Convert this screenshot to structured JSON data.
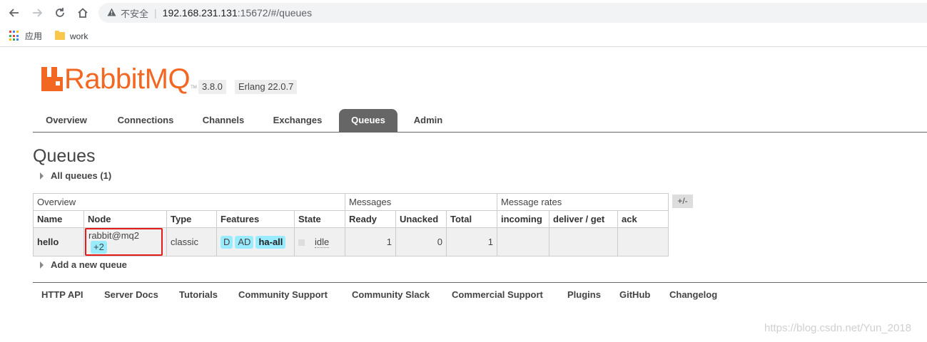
{
  "browser": {
    "insecure_label": "不安全",
    "url_host": "192.168.231.131",
    "url_path": ":15672/#/queues",
    "bookmarks": [
      {
        "label": "应用",
        "icon": "apps-grid-icon"
      },
      {
        "label": "work",
        "icon": "folder-icon"
      }
    ]
  },
  "app": {
    "logo_text": "RabbitMQ",
    "logo_tm": "TM",
    "version": "3.8.0",
    "erlang": "Erlang 22.0.7"
  },
  "tabs": [
    "Overview",
    "Connections",
    "Channels",
    "Exchanges",
    "Queues",
    "Admin"
  ],
  "active_tab": "Queues",
  "page": {
    "title": "Queues",
    "all_queues": "All queues (1)",
    "add_queue": "Add a new queue"
  },
  "table": {
    "groups": [
      "Overview",
      "Messages",
      "Message rates"
    ],
    "columns": [
      "Name",
      "Node",
      "Type",
      "Features",
      "State",
      "Ready",
      "Unacked",
      "Total",
      "incoming",
      "deliver / get",
      "ack"
    ],
    "toggle": "+/-",
    "rows": [
      {
        "name": "hello",
        "node": "rabbit@mq2",
        "node_extra": "+2",
        "type": "classic",
        "features": [
          "D",
          "AD",
          "ha-all"
        ],
        "state": "idle",
        "ready": "1",
        "unacked": "0",
        "total": "1",
        "incoming": "",
        "deliver_get": "",
        "ack": ""
      }
    ]
  },
  "footer": [
    "HTTP API",
    "Server Docs",
    "Tutorials",
    "Community Support",
    "Community Slack",
    "Commercial Support",
    "Plugins",
    "GitHub",
    "Changelog"
  ],
  "watermark": "https://blog.csdn.net/Yun_2018",
  "colors": {
    "brand": "#f26822",
    "tab_active": "#666666",
    "feature_tag": "#99ebff",
    "highlight_box": "#e31b1b"
  }
}
